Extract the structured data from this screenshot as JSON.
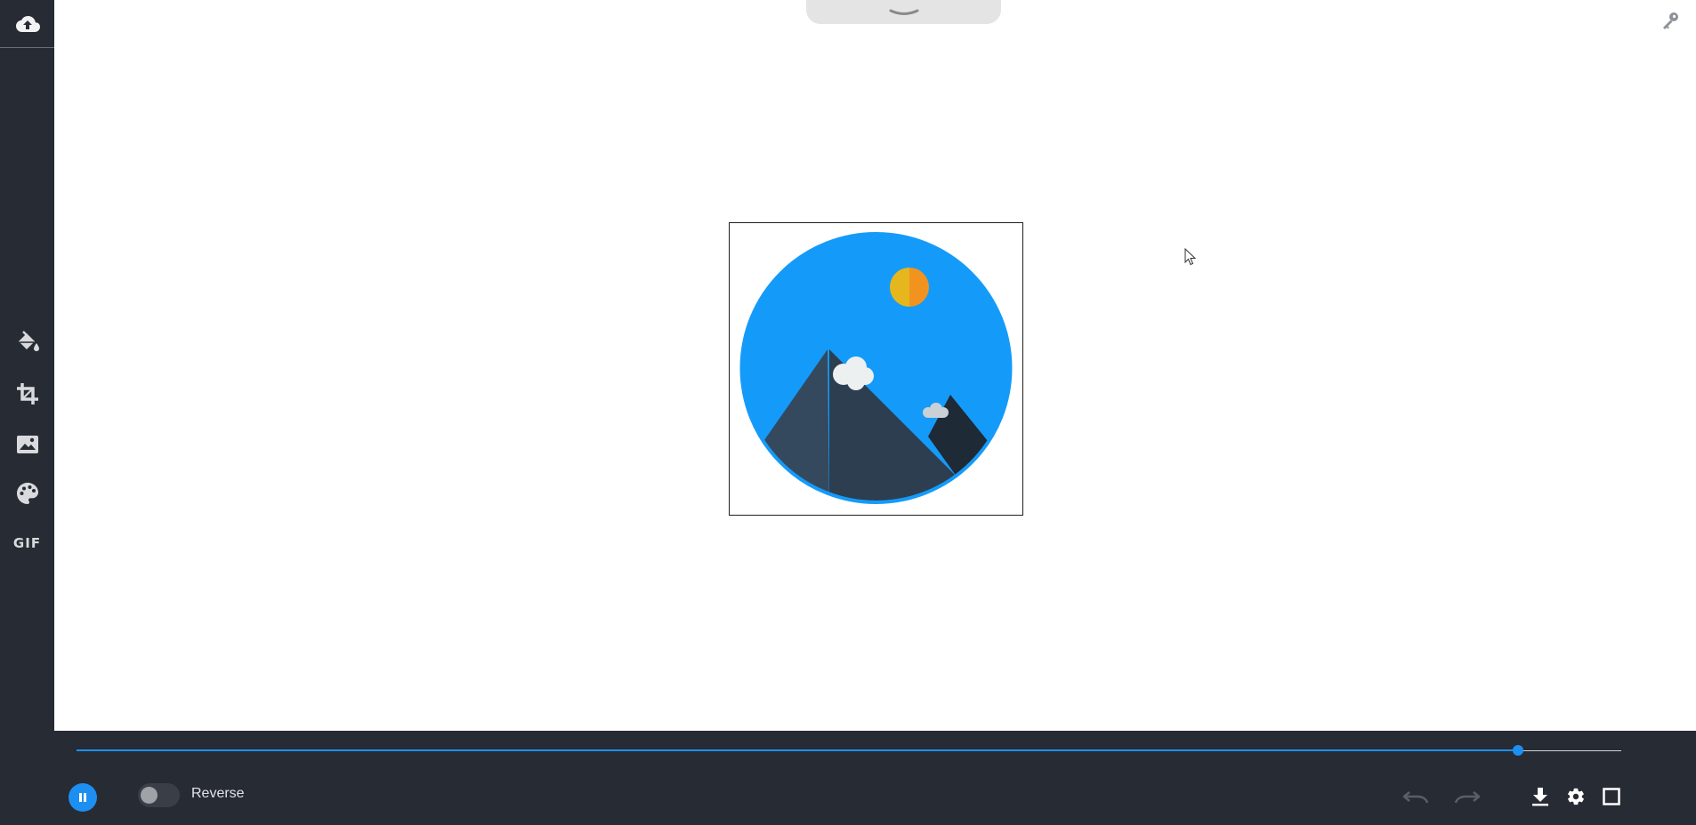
{
  "sidebar": {
    "items": [
      {
        "name": "upload",
        "icon": "cloud-upload-icon"
      },
      {
        "name": "fill",
        "icon": "paint-bucket-icon"
      },
      {
        "name": "crop",
        "icon": "crop-icon"
      },
      {
        "name": "image",
        "icon": "image-icon"
      },
      {
        "name": "color",
        "icon": "palette-icon"
      },
      {
        "name": "gif",
        "label": "GIF"
      }
    ]
  },
  "canvas": {
    "top_tab_icon": "chevron-down-icon",
    "corner_icon": "key-icon",
    "artwork": "mountain-landscape-icon"
  },
  "player": {
    "progress": 0.933,
    "play_state_icon": "pause-icon",
    "reverse_label": "Reverse",
    "reverse_on": false,
    "icons": [
      "undo-icon",
      "redo-icon",
      "download-icon",
      "settings-icon",
      "fullscreen-icon"
    ]
  },
  "colors": {
    "sidebar_bg": "#272b33",
    "accent": "#1d8ff2",
    "sky": "#149bf9",
    "sun_left": "#e5b71d",
    "sun_right": "#f29320"
  }
}
